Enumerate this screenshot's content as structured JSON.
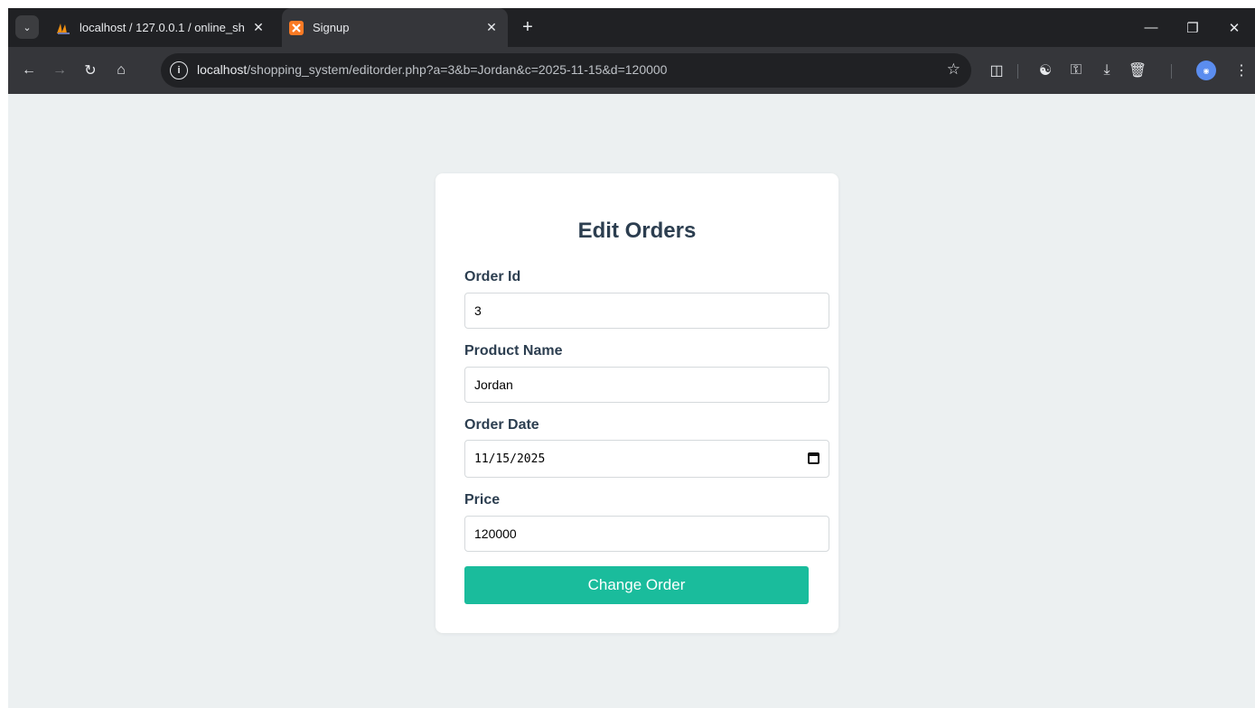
{
  "browser": {
    "tabs": [
      {
        "title": "localhost / 127.0.0.1 / online_sh",
        "active": false,
        "favicon": "phpmyadmin-icon"
      },
      {
        "title": "Signup",
        "active": true,
        "favicon": "xampp-icon"
      }
    ],
    "new_tab_label": "+",
    "url_host": "localhost",
    "url_rest": "/shopping_system/editorder.php?a=3&b=Jordan&c=2025-11-15&d=120000"
  },
  "form": {
    "title": "Edit Orders",
    "order_id_label": "Order Id",
    "order_id_value": "3",
    "product_name_label": "Product Name",
    "product_name_value": "Jordan",
    "order_date_label": "Order Date",
    "order_date_value": "11/15/2025",
    "price_label": "Price",
    "price_value": "120000",
    "submit_label": "Change Order"
  },
  "colors": {
    "page_bg": "#ecf0f1",
    "heading": "#2c3e50",
    "button": "#1abc9c"
  }
}
